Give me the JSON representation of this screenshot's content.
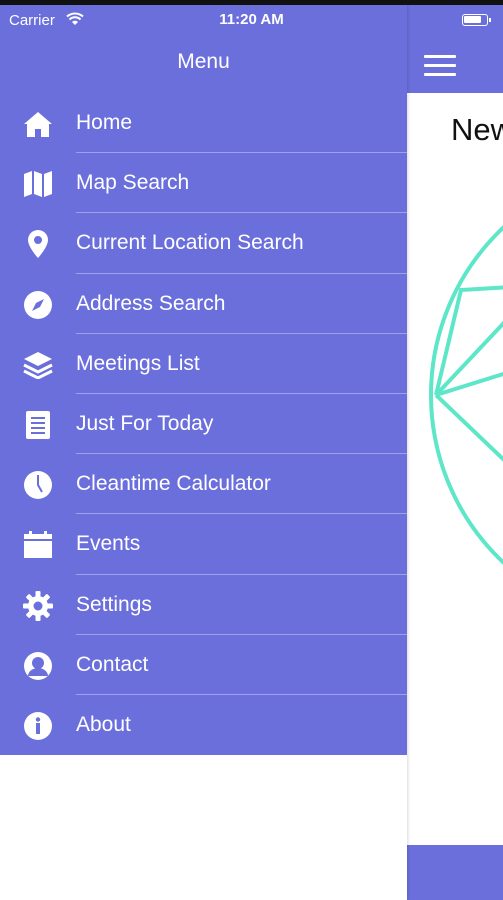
{
  "status_bar": {
    "carrier": "Carrier",
    "time": "11:20 AM"
  },
  "drawer": {
    "title": "Menu",
    "items": [
      {
        "label": "Home",
        "icon": "home-icon"
      },
      {
        "label": "Map Search",
        "icon": "map-icon"
      },
      {
        "label": "Current Location Search",
        "icon": "location-pin-icon"
      },
      {
        "label": "Address Search",
        "icon": "compass-icon"
      },
      {
        "label": "Meetings List",
        "icon": "layers-icon"
      },
      {
        "label": "Just For Today",
        "icon": "document-icon"
      },
      {
        "label": "Cleantime Calculator",
        "icon": "clock-icon"
      },
      {
        "label": "Events",
        "icon": "calendar-icon"
      },
      {
        "label": "Settings",
        "icon": "gear-icon"
      },
      {
        "label": "Contact",
        "icon": "person-icon"
      },
      {
        "label": "About",
        "icon": "info-icon"
      }
    ]
  },
  "main": {
    "title_partial": "New"
  },
  "colors": {
    "accent": "#6b6fdc",
    "logo": "#5ee6c8"
  }
}
